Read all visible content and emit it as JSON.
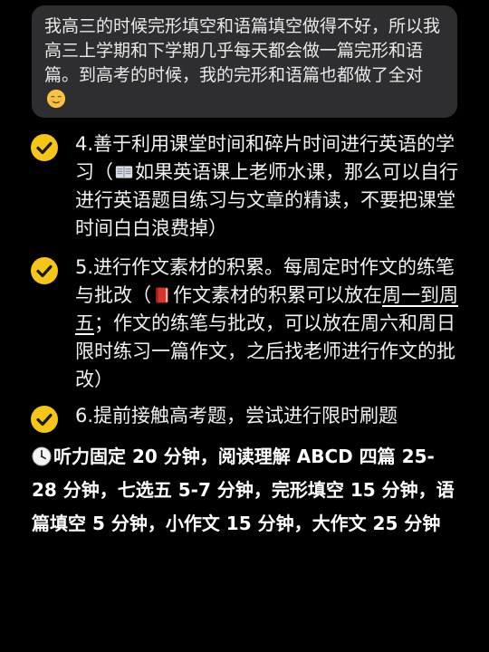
{
  "bubble": {
    "text": "我高三的时候完形填空和语篇填空做得不好，所以我高三上学期和下学期几乎每天都会做一篇完形和语篇。到高考的时候，我的完形和语篇也都做了全对",
    "emoji_icon": "relieved-face-icon"
  },
  "items": [
    {
      "icon": "check-mark-icon",
      "text_a": "4.善于利用课堂时间和碎片时间进行英语的学习（",
      "emoji_icon": "open-book-icon",
      "text_b": "如果英语课上老师水课，那么可以自行进行英语题目练习与文章的精读，不要把课堂时间白白浪费掉）"
    },
    {
      "icon": "check-mark-icon",
      "text_a": "5.进行作文素材的积累。每周定时作文的练笔与批改（",
      "emoji_icon": "red-book-icon",
      "text_b": "作文素材的积累可以放在",
      "text_underlined": "周一到周五",
      "text_c": "；作文的练笔与批改，可以放在周六和周日限时练习一篇作文，之后找老师进行作文的批改）"
    },
    {
      "icon": "check-mark-icon",
      "text_a": "6.提前接触高考题，尝试进行限时刷题"
    }
  ],
  "tips": {
    "icon": "clock-icon",
    "text": "听力固定 20 分钟，阅读理解 ABCD 四篇 25-28 分钟，七选五 5-7 分钟，完形填空 15 分钟，语篇填空 5 分钟，小作文 15 分钟，大作文 25 分钟"
  },
  "colors": {
    "background": "#000000",
    "bubble": "#2e2e30",
    "check": "#f5c518"
  }
}
